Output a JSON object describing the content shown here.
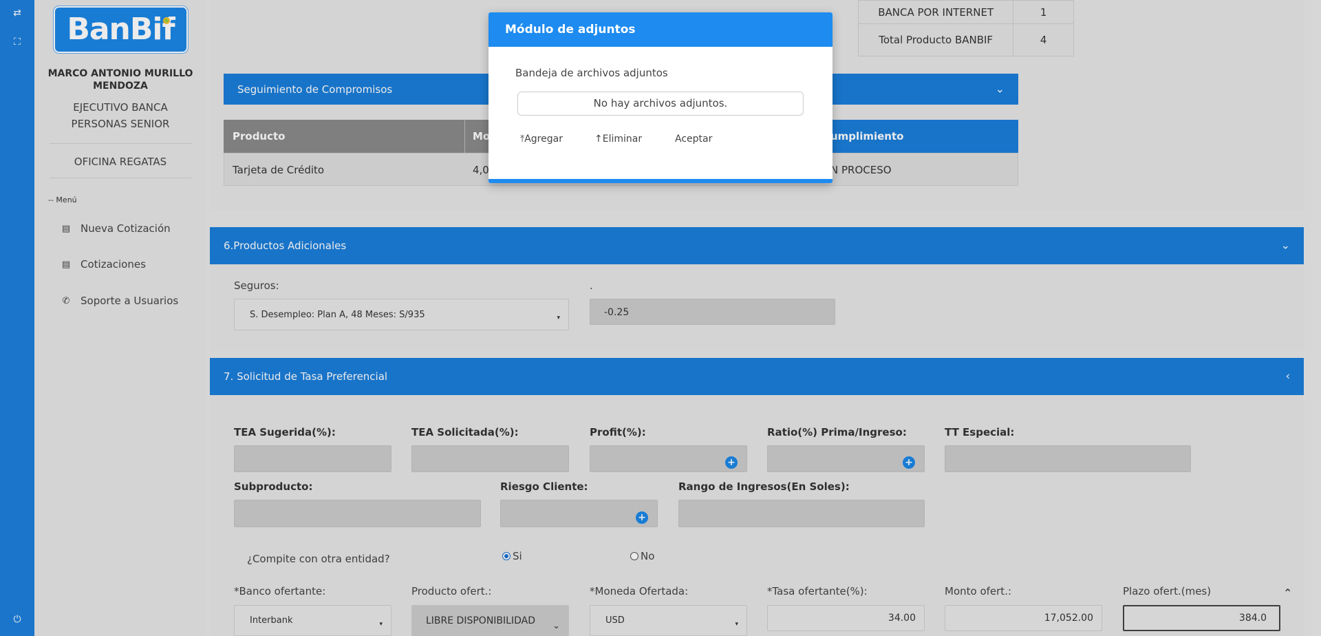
{
  "brand": {
    "logo_text": "BanBif"
  },
  "user": {
    "name": "MARCO ANTONIO MURILLO MENDOZA",
    "role": "EJECUTIVO BANCA PERSONAS SENIOR",
    "office": "OFICINA REGATAS"
  },
  "menu": {
    "header": "-- Menú",
    "items": [
      {
        "label": "Nueva Cotización",
        "icon": "id-card-icon"
      },
      {
        "label": "Cotizaciones",
        "icon": "id-card-icon"
      },
      {
        "label": "Soporte a Usuarios",
        "icon": "phone-icon"
      }
    ]
  },
  "rail": {
    "icons": [
      "swap-arrows-icon",
      "fullscreen-icon",
      "power-icon"
    ]
  },
  "products_summary": {
    "rows": [
      {
        "label": "BANCA POR INTERNET",
        "value": "1"
      },
      {
        "label": "Total Producto BANBIF",
        "value": "4"
      }
    ]
  },
  "compromisos": {
    "title": "Seguimiento de Compromisos",
    "headers": [
      "Producto",
      "Mo",
      "umplimiento"
    ],
    "rows": [
      {
        "producto": "Tarjeta de Crédito",
        "monto": "4,0",
        "cumplimiento": "N PROCESO"
      }
    ]
  },
  "section6": {
    "title": "6.Productos Adicionales",
    "seguros_label": "Seguros:",
    "seguros_value": "S. Desempleo: Plan A, 48 Meses: S/935",
    "dot_label": ".",
    "rate_value": "-0.25"
  },
  "section7": {
    "title": "7. Solicitud de Tasa Preferencial",
    "row1": [
      "TEA Sugerida(%):",
      "TEA Solicitada(%):",
      "Profit(%):",
      "Ratio(%) Prima/Ingreso:",
      "TT Especial:"
    ],
    "row2": [
      "Subproducto:",
      "Riesgo Cliente:",
      "Rango de Ingresos(En Soles):"
    ],
    "compite_label": "¿Compite con otra entidad?",
    "radio_si": "Si",
    "radio_no": "No",
    "row3_labels": [
      "*Banco ofertante:",
      "Producto ofert.:",
      "*Moneda Ofertada:",
      "*Tasa ofertante(%):",
      "Monto ofert.:",
      "Plazo ofert.(mes)"
    ],
    "banco": "Interbank",
    "producto": "LIBRE DISPONIBILIDAD",
    "moneda": "USD",
    "tasa": "34.00",
    "monto": "17,052.00",
    "plazo": "384.0"
  },
  "modal": {
    "title": "Módulo de adjuntos",
    "subtitle": "Bandeja de archivos adjuntos",
    "empty": "No hay archivos adjuntos.",
    "add_label": "Agregar",
    "delete_label": "Eliminar",
    "accept_label": "Aceptar"
  },
  "colors": {
    "primary": "#1b7edb",
    "modal_header": "#1d8bf0"
  }
}
